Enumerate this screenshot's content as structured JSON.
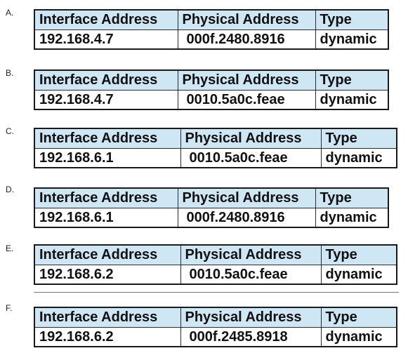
{
  "headers": {
    "interface": "Interface Address",
    "physical": "Physical Address",
    "type": "Type"
  },
  "options": [
    {
      "label": "A.",
      "interface": "192.168.4.7",
      "physical": "000f.2480.8916",
      "type": "dynamic"
    },
    {
      "label": "B.",
      "interface": "192.168.4.7",
      "physical": "0010.5a0c.feae",
      "type": "dynamic"
    },
    {
      "label": "C.",
      "interface": "192.168.6.1",
      "physical": "0010.5a0c.feae",
      "type": "dynamic"
    },
    {
      "label": "D.",
      "interface": "192.168.6.1",
      "physical": "000f.2480.8916",
      "type": "dynamic"
    },
    {
      "label": "E.",
      "interface": "192.168.6.2",
      "physical": "0010.5a0c.feae",
      "type": "dynamic"
    },
    {
      "label": "F.",
      "interface": "192.168.6.2",
      "physical": "000f.2485.8918",
      "type": "dynamic"
    }
  ]
}
